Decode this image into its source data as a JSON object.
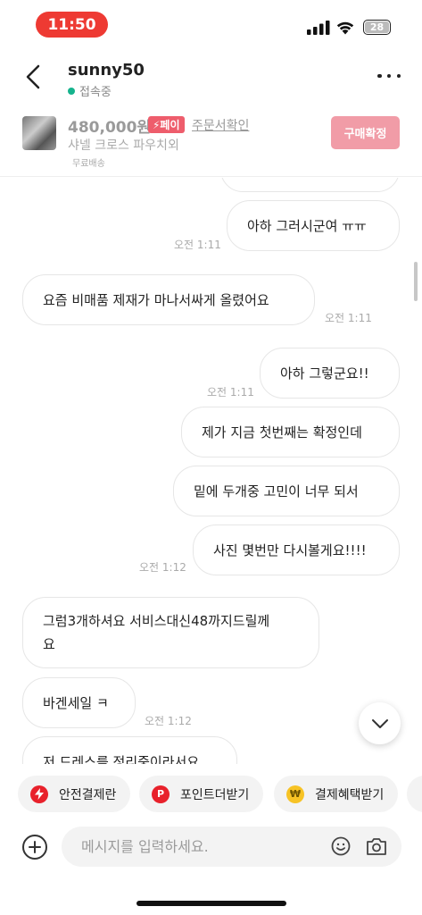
{
  "status_bar": {
    "time": "11:50",
    "battery": "28"
  },
  "header": {
    "username": "sunny50",
    "status": "접속중"
  },
  "product": {
    "price": "480,000원",
    "pay_badge": "⚡페이",
    "order_link": "주문서확인",
    "title": "샤넬 크로스 파우치외",
    "shipping": "무료배송",
    "confirm_button": "구매확정"
  },
  "messages": [
    {
      "side": "right",
      "text": ""
    },
    {
      "side": "right",
      "text": "아하 그러시군여 ㅠㅠ",
      "time": "오전 1:11"
    },
    {
      "side": "left",
      "text": "요즘 비매품 제재가 마나서싸게 올렸어요",
      "time": "오전 1:11"
    },
    {
      "side": "right",
      "text": "아하 그렇군요!!",
      "time": "오전 1:11"
    },
    {
      "side": "right",
      "text": "제가 지금 첫번째는 확정인데"
    },
    {
      "side": "right",
      "text": "밑에 두개중 고민이 너무 되서"
    },
    {
      "side": "right",
      "text": "사진 몇번만 다시볼게요!!!!",
      "time": "오전 1:12"
    },
    {
      "side": "left",
      "text_line1": "그럼3개하셔요 서비스대신48까지드릴께",
      "text_line2": "요"
    },
    {
      "side": "left",
      "text": "바겐세일 ㅋ",
      "time": "오전 1:12"
    },
    {
      "side": "left",
      "text": "저 드레스를 정리중이라서요"
    }
  ],
  "quick_actions": [
    {
      "label": "안전결제란",
      "icon": "lightning-icon",
      "color": "#e8212b"
    },
    {
      "label": "포인트더받기",
      "icon": "point-p-icon",
      "color": "#e8212b"
    },
    {
      "label": "결제혜택받기",
      "icon": "won-coin-icon",
      "color": "#f7c325"
    }
  ],
  "input": {
    "placeholder": "메시지를 입력하세요."
  }
}
